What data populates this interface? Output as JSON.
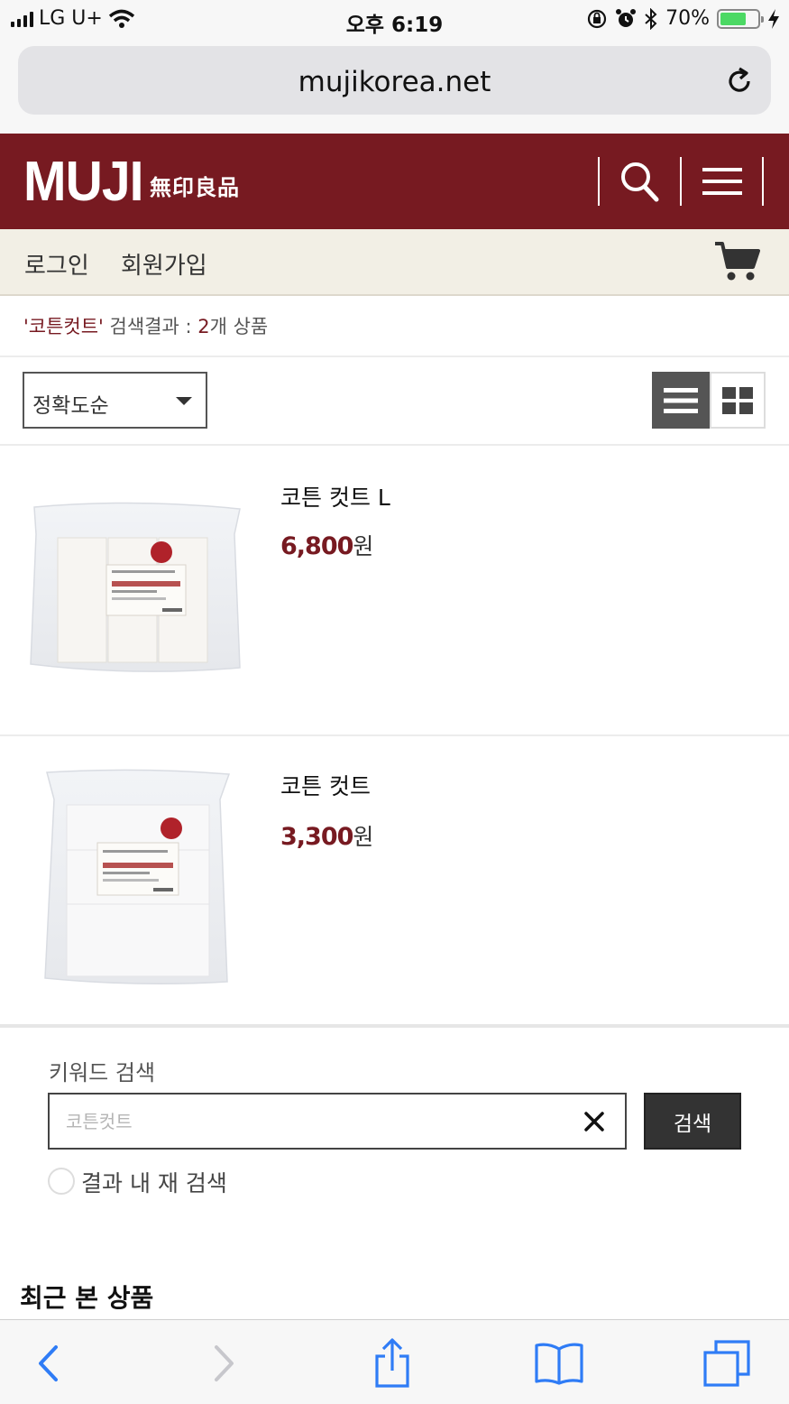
{
  "status_bar": {
    "carrier": "LG U+",
    "time": "오후 6:19",
    "battery": "70%",
    "battery_level": 0.7
  },
  "browser": {
    "url": "mujikorea.net"
  },
  "header": {
    "logo": "MUJI",
    "logo_sub": "無印良品",
    "brand_color": "#771a21"
  },
  "member_nav": {
    "login": "로그인",
    "signup": "회원가입"
  },
  "search_result": {
    "keyword": "'코튼컷트'",
    "label": " 검색결과 : ",
    "count": "2",
    "suffix": "개 상품"
  },
  "sort": {
    "selected": "정확도순"
  },
  "products": [
    {
      "name": "코튼 컷트 L",
      "price": "6,800",
      "unit": "원"
    },
    {
      "name": "코튼 컷트",
      "price": "3,300",
      "unit": "원"
    }
  ],
  "keyword_search": {
    "title": "키워드 검색",
    "placeholder": "코튼컷트",
    "button": "검색",
    "within_results": "결과 내 재 검색"
  },
  "recent": {
    "title": "최근 본 상품"
  }
}
